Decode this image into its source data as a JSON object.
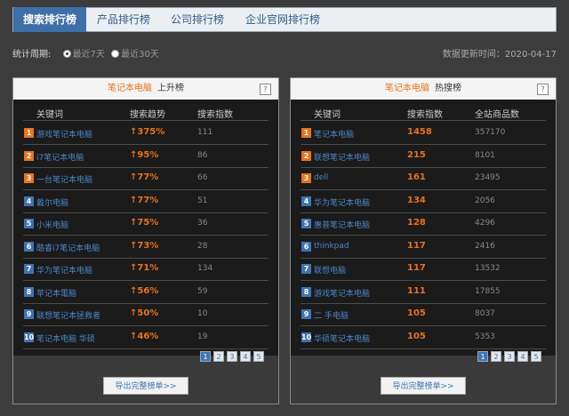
{
  "tabs": [
    {
      "label": "搜索排行榜"
    },
    {
      "label": "产品排行榜"
    },
    {
      "label": "公司排行榜"
    },
    {
      "label": "企业官网排行榜"
    }
  ],
  "period": {
    "label": "统计周期:",
    "options": [
      "最近7天",
      "最近30天"
    ],
    "selected": "最近7天"
  },
  "updated": "数据更新时间：2020-04-17",
  "left": {
    "highlight": "笔记本电脑",
    "title": "上升榜",
    "help": "?",
    "columns": [
      "关键词",
      "搜索趋势",
      "搜索指数"
    ],
    "rows": [
      {
        "rank": "1",
        "keyword": "游戏笔记本电脑",
        "trend": "375%",
        "index": "111"
      },
      {
        "rank": "2",
        "keyword": "i7笔记本电脑",
        "trend": "95%",
        "index": "86"
      },
      {
        "rank": "3",
        "keyword": "一台笔记本电脑",
        "trend": "77%",
        "index": "66"
      },
      {
        "rank": "4",
        "keyword": "戴尔电脑",
        "trend": "77%",
        "index": "51"
      },
      {
        "rank": "5",
        "keyword": "小米电脑",
        "trend": "75%",
        "index": "36"
      },
      {
        "rank": "6",
        "keyword": "酷睿i7笔记本电脑",
        "trend": "73%",
        "index": "28"
      },
      {
        "rank": "7",
        "keyword": "华为笔记本电脑",
        "trend": "71%",
        "index": "134"
      },
      {
        "rank": "8",
        "keyword": "苹记本電脑",
        "trend": "56%",
        "index": "59"
      },
      {
        "rank": "9",
        "keyword": "联想笔记本拯救者",
        "trend": "50%",
        "index": "10"
      },
      {
        "rank": "10",
        "keyword": "笔记本电脑 华硕",
        "trend": "46%",
        "index": "19"
      }
    ],
    "pages": [
      "1",
      "2",
      "3",
      "4",
      "5"
    ],
    "export": "导出完整榜单>>"
  },
  "right": {
    "highlight": "笔记本电脑",
    "title": "热搜榜",
    "help": "?",
    "columns": [
      "关键词",
      "搜索指数",
      "全站商品数"
    ],
    "rows": [
      {
        "rank": "1",
        "keyword": "笔记本电脑",
        "index": "1458",
        "products": "357170"
      },
      {
        "rank": "2",
        "keyword": "联想笔记本电脑",
        "index": "215",
        "products": "8101"
      },
      {
        "rank": "3",
        "keyword": "dell",
        "index": "161",
        "products": "23495"
      },
      {
        "rank": "4",
        "keyword": "华为笔记本电脑",
        "index": "134",
        "products": "2056"
      },
      {
        "rank": "5",
        "keyword": "惠普笔记本电脑",
        "index": "128",
        "products": "4296"
      },
      {
        "rank": "6",
        "keyword": "thinkpad",
        "index": "117",
        "products": "2416"
      },
      {
        "rank": "7",
        "keyword": "联想电脑",
        "index": "117",
        "products": "13532"
      },
      {
        "rank": "8",
        "keyword": "游戏笔记本电脑",
        "index": "111",
        "products": "17855"
      },
      {
        "rank": "9",
        "keyword": "二 手电脑",
        "index": "105",
        "products": "8037"
      },
      {
        "rank": "10",
        "keyword": "华硕笔记本电脑",
        "index": "105",
        "products": "5353"
      }
    ],
    "pages": [
      "1",
      "2",
      "3",
      "4",
      "5"
    ],
    "export": "导出完整榜单>>"
  }
}
